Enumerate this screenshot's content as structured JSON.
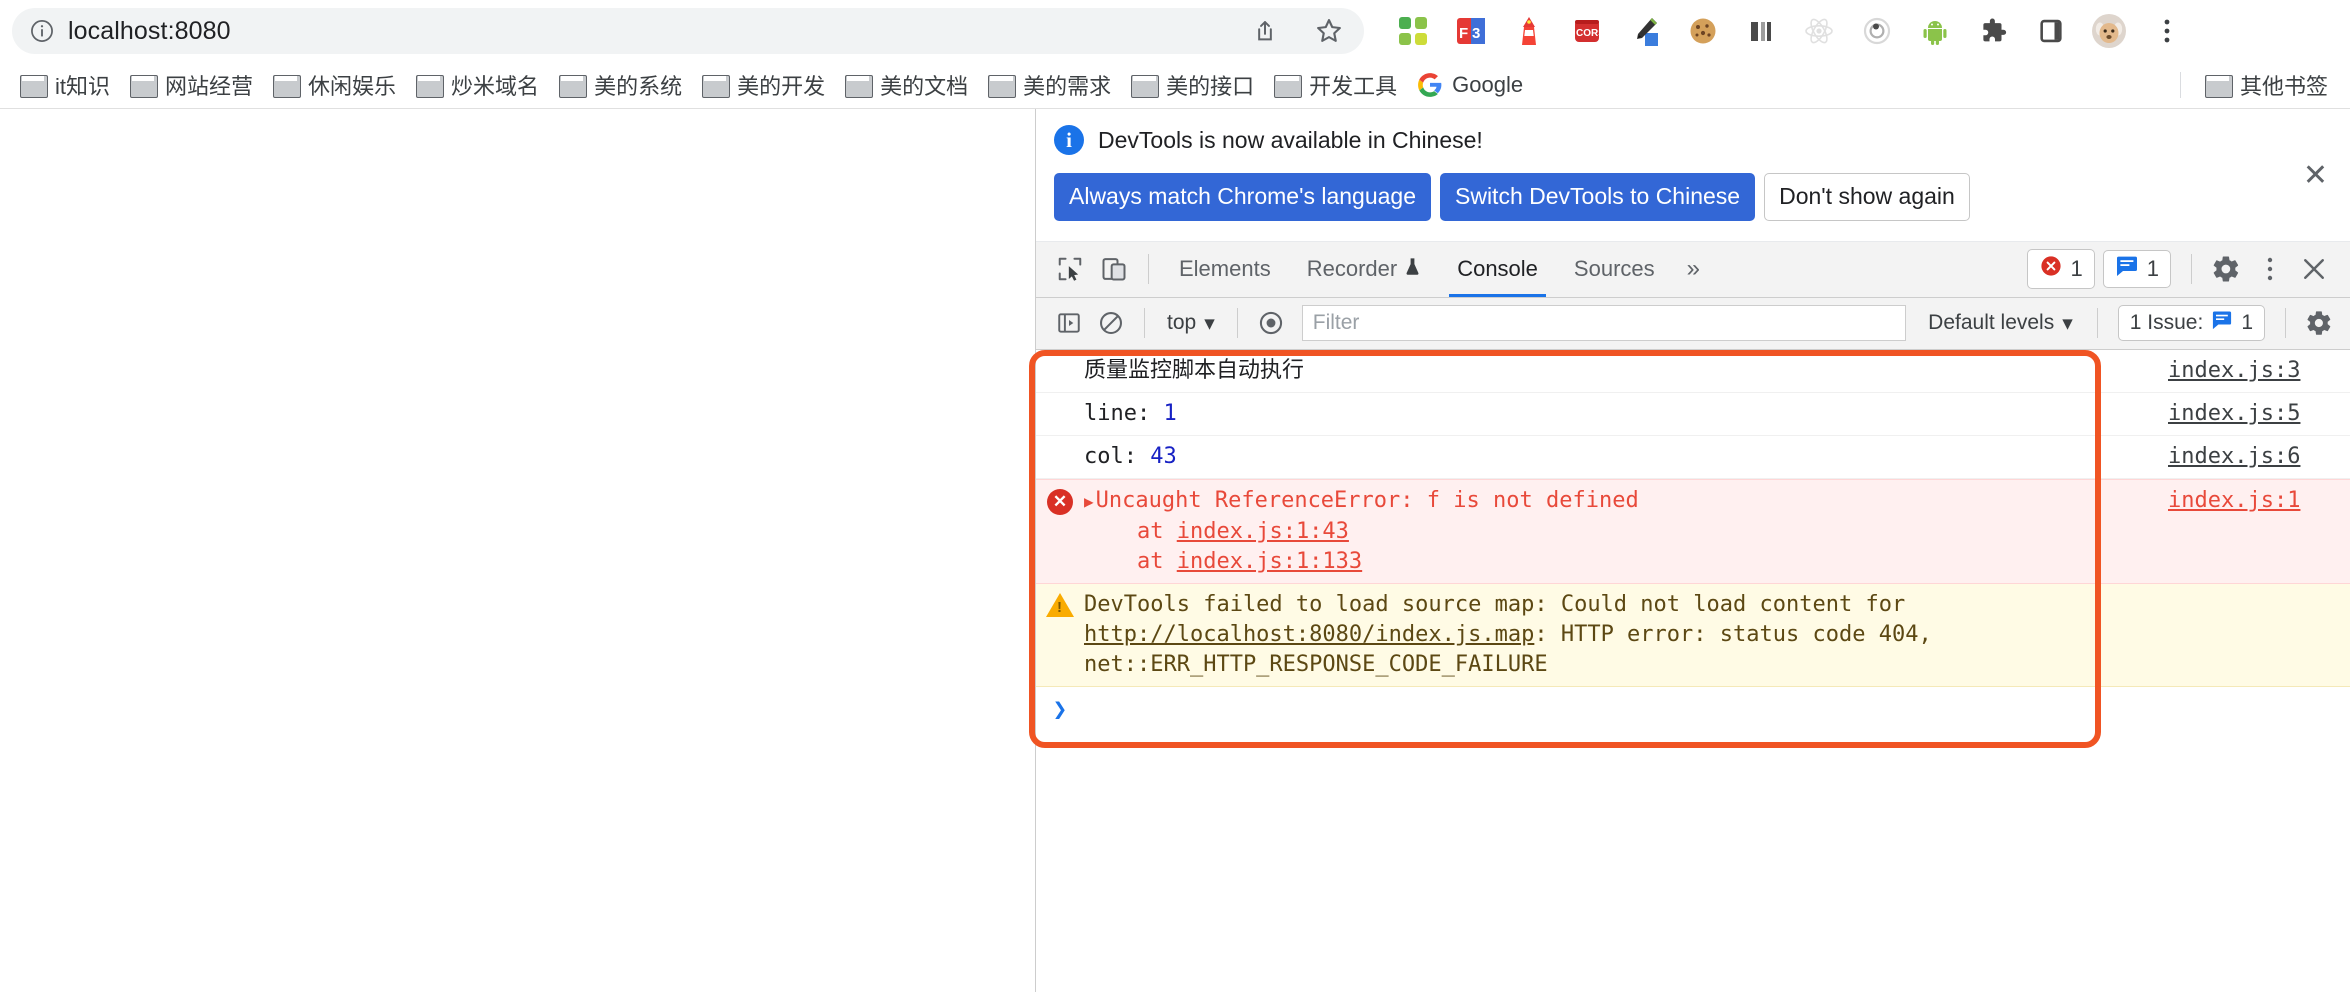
{
  "browser": {
    "omnibox": {
      "url": "localhost:8080",
      "site_info_icon": "info-circle-icon",
      "share_icon": "share-icon",
      "bookmark_icon": "star-icon"
    },
    "extensions": [
      {
        "name": "pinterest-extension-icon",
        "glyph": "▒"
      },
      {
        "name": "feedly-extension-icon",
        "glyph": "F3"
      },
      {
        "name": "lighthouse-extension-icon",
        "glyph": "⌂"
      },
      {
        "name": "cors-unblock-extension-icon",
        "glyph": "CORS"
      },
      {
        "name": "eyedropper-extension-icon",
        "glyph": "✒"
      },
      {
        "name": "cookie-editor-extension-icon",
        "glyph": "🍪"
      },
      {
        "name": "split-view-extension-icon",
        "glyph": "▮▮"
      },
      {
        "name": "react-devtools-extension-icon",
        "glyph": "⚛"
      },
      {
        "name": "vue-devtools-extension-icon",
        "glyph": "◎"
      },
      {
        "name": "android-extension-icon",
        "glyph": "🤖"
      },
      {
        "name": "extensions-puzzle-icon",
        "glyph": "🧩"
      },
      {
        "name": "side-panel-icon",
        "glyph": "▯"
      },
      {
        "name": "profile-avatar-icon",
        "glyph": "🐶"
      },
      {
        "name": "chrome-menu-icon",
        "glyph": "⋮"
      }
    ],
    "bookmarks": [
      {
        "label": "it知识",
        "icon": "folder-icon"
      },
      {
        "label": "网站经营",
        "icon": "folder-icon"
      },
      {
        "label": "休闲娱乐",
        "icon": "folder-icon"
      },
      {
        "label": "炒米域名",
        "icon": "folder-icon"
      },
      {
        "label": "美的系统",
        "icon": "folder-icon"
      },
      {
        "label": "美的开发",
        "icon": "folder-icon"
      },
      {
        "label": "美的文档",
        "icon": "folder-icon"
      },
      {
        "label": "美的需求",
        "icon": "folder-icon"
      },
      {
        "label": "美的接口",
        "icon": "folder-icon"
      },
      {
        "label": "开发工具",
        "icon": "folder-icon"
      },
      {
        "label": "Google",
        "icon": "google-icon"
      }
    ],
    "other_bookmarks": {
      "label": "其他书签",
      "icon": "folder-icon"
    }
  },
  "devtools": {
    "banner": {
      "message": "DevTools is now available in Chinese!",
      "buttons": [
        {
          "label": "Always match Chrome's language",
          "style": "primary"
        },
        {
          "label": "Switch DevTools to Chinese",
          "style": "primary"
        },
        {
          "label": "Don't show again",
          "style": "secondary"
        }
      ],
      "close_label": "✕"
    },
    "tabs": [
      {
        "label": "Elements",
        "active": false
      },
      {
        "label": "Recorder",
        "active": false,
        "suffix_icon": "flask-icon"
      },
      {
        "label": "Console",
        "active": true
      },
      {
        "label": "Sources",
        "active": false
      }
    ],
    "more_tabs_label": "»",
    "error_count": "1",
    "warning_count": "1",
    "settings_icon_label": "⚙",
    "menu_icon_label": "⋮",
    "close_icon_label": "✕",
    "console_toolbar": {
      "context": "top",
      "filter_placeholder": "Filter",
      "levels": "Default levels",
      "issues": "1 Issue:",
      "issues_count": "1"
    },
    "console_messages": [
      {
        "type": "log",
        "text": "质量监控脚本自动执行",
        "source": "index.js:3"
      },
      {
        "type": "log",
        "label": "line: ",
        "value": "1",
        "source": "index.js:5"
      },
      {
        "type": "log",
        "label": "col: ",
        "value": "43",
        "source": "index.js:6"
      },
      {
        "type": "error",
        "title": "Uncaught ReferenceError: f is not defined",
        "stack": [
          {
            "at": "at ",
            "link": "index.js:1:43"
          },
          {
            "at": "at ",
            "link": "index.js:1:133"
          }
        ],
        "source": "index.js:1"
      },
      {
        "type": "warning",
        "text_before": "DevTools failed to load source map: Could not load content for ",
        "link": "http://localhost:8080/index.js.map",
        "text_after": ": HTTP error: status code 404,\nnet::ERR_HTTP_RESPONSE_CODE_FAILURE",
        "source": ""
      }
    ],
    "prompt_chevron": "❯"
  },
  "annotation": {
    "highlight_color": "#f05423"
  }
}
